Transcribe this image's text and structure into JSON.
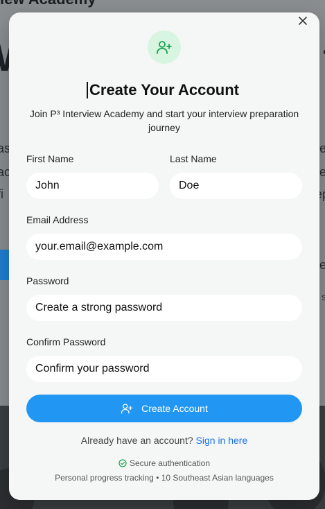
{
  "background": {
    "header_fragment": "iew Academy",
    "big_left": "W",
    "big_right": "t",
    "fragments_left": [
      "as",
      "ac",
      "fi"
    ],
    "fragments_right": [
      "e",
      "e",
      "ep",
      "e",
      "s"
    ]
  },
  "modal": {
    "title": "Create Your Account",
    "subtitle": "Join P³ Interview Academy and start your interview preparation journey",
    "close_icon": "close-icon",
    "header_icon": "user-plus-icon",
    "first_name": {
      "label": "First Name",
      "value": "John"
    },
    "last_name": {
      "label": "Last Name",
      "value": "Doe"
    },
    "email": {
      "label": "Email Address",
      "placeholder": "your.email@example.com"
    },
    "password": {
      "label": "Password",
      "placeholder": "Create a strong password"
    },
    "confirm_password": {
      "label": "Confirm Password",
      "placeholder": "Confirm your password"
    },
    "submit_label": "Create Account",
    "signin_prompt": "Already have an account?",
    "signin_link": "Sign in here",
    "secure_text": "Secure authentication",
    "footer_note": "Personal progress tracking • 10 Southeast Asian languages",
    "colors": {
      "accent": "#2196f3",
      "link": "#1a73e8",
      "icon_green": "#16a34a",
      "icon_bg": "#d8f5e1"
    }
  }
}
